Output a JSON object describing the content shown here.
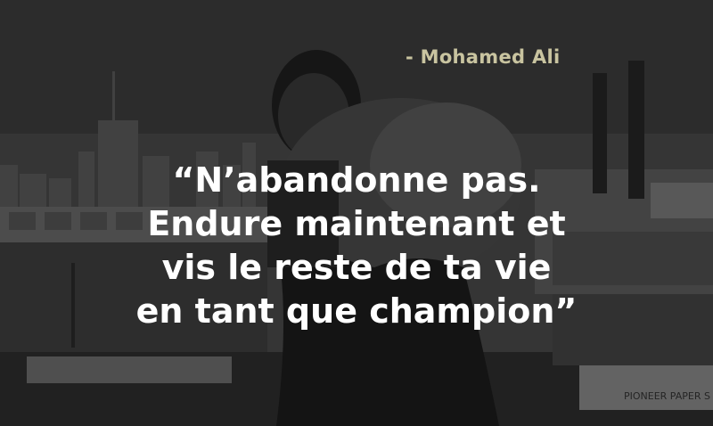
{
  "attribution": "- Mohamed Ali",
  "quote_lines": [
    "“N’abandonne pas.",
    "Endure maintenant et",
    "vis le reste de ta vie",
    "en tant que champion”"
  ],
  "sign_text": "PIONEER PAPER S",
  "colors": {
    "attribution": "#c9c4a0",
    "quote": "#ffffff"
  }
}
